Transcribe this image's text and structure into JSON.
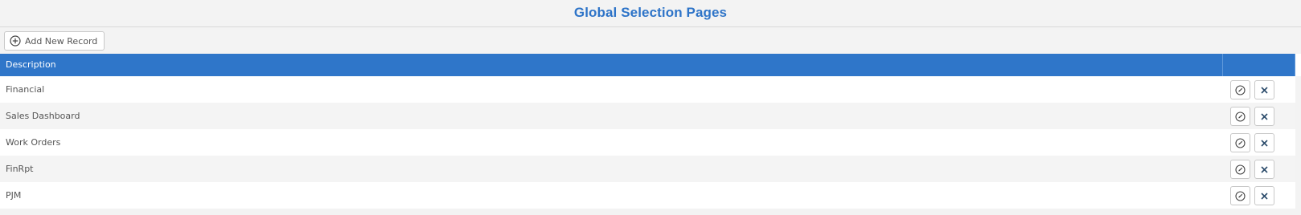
{
  "page": {
    "title": "Global Selection Pages"
  },
  "toolbar": {
    "add_label": "Add New Record",
    "add_icon": "plus-circle-icon"
  },
  "table": {
    "columns": [
      "Description",
      ""
    ],
    "rows": [
      {
        "description": "Financial"
      },
      {
        "description": "Sales Dashboard"
      },
      {
        "description": "Work Orders"
      },
      {
        "description": "FinRpt"
      },
      {
        "description": "PJM"
      }
    ],
    "row_actions": {
      "edit_icon": "edit-compass-icon",
      "delete_icon": "close-icon"
    }
  },
  "colors": {
    "accent": "#2f76c9",
    "title": "#2e74c8",
    "background": "#f3f3f3",
    "row_alt": "#f4f4f4"
  }
}
